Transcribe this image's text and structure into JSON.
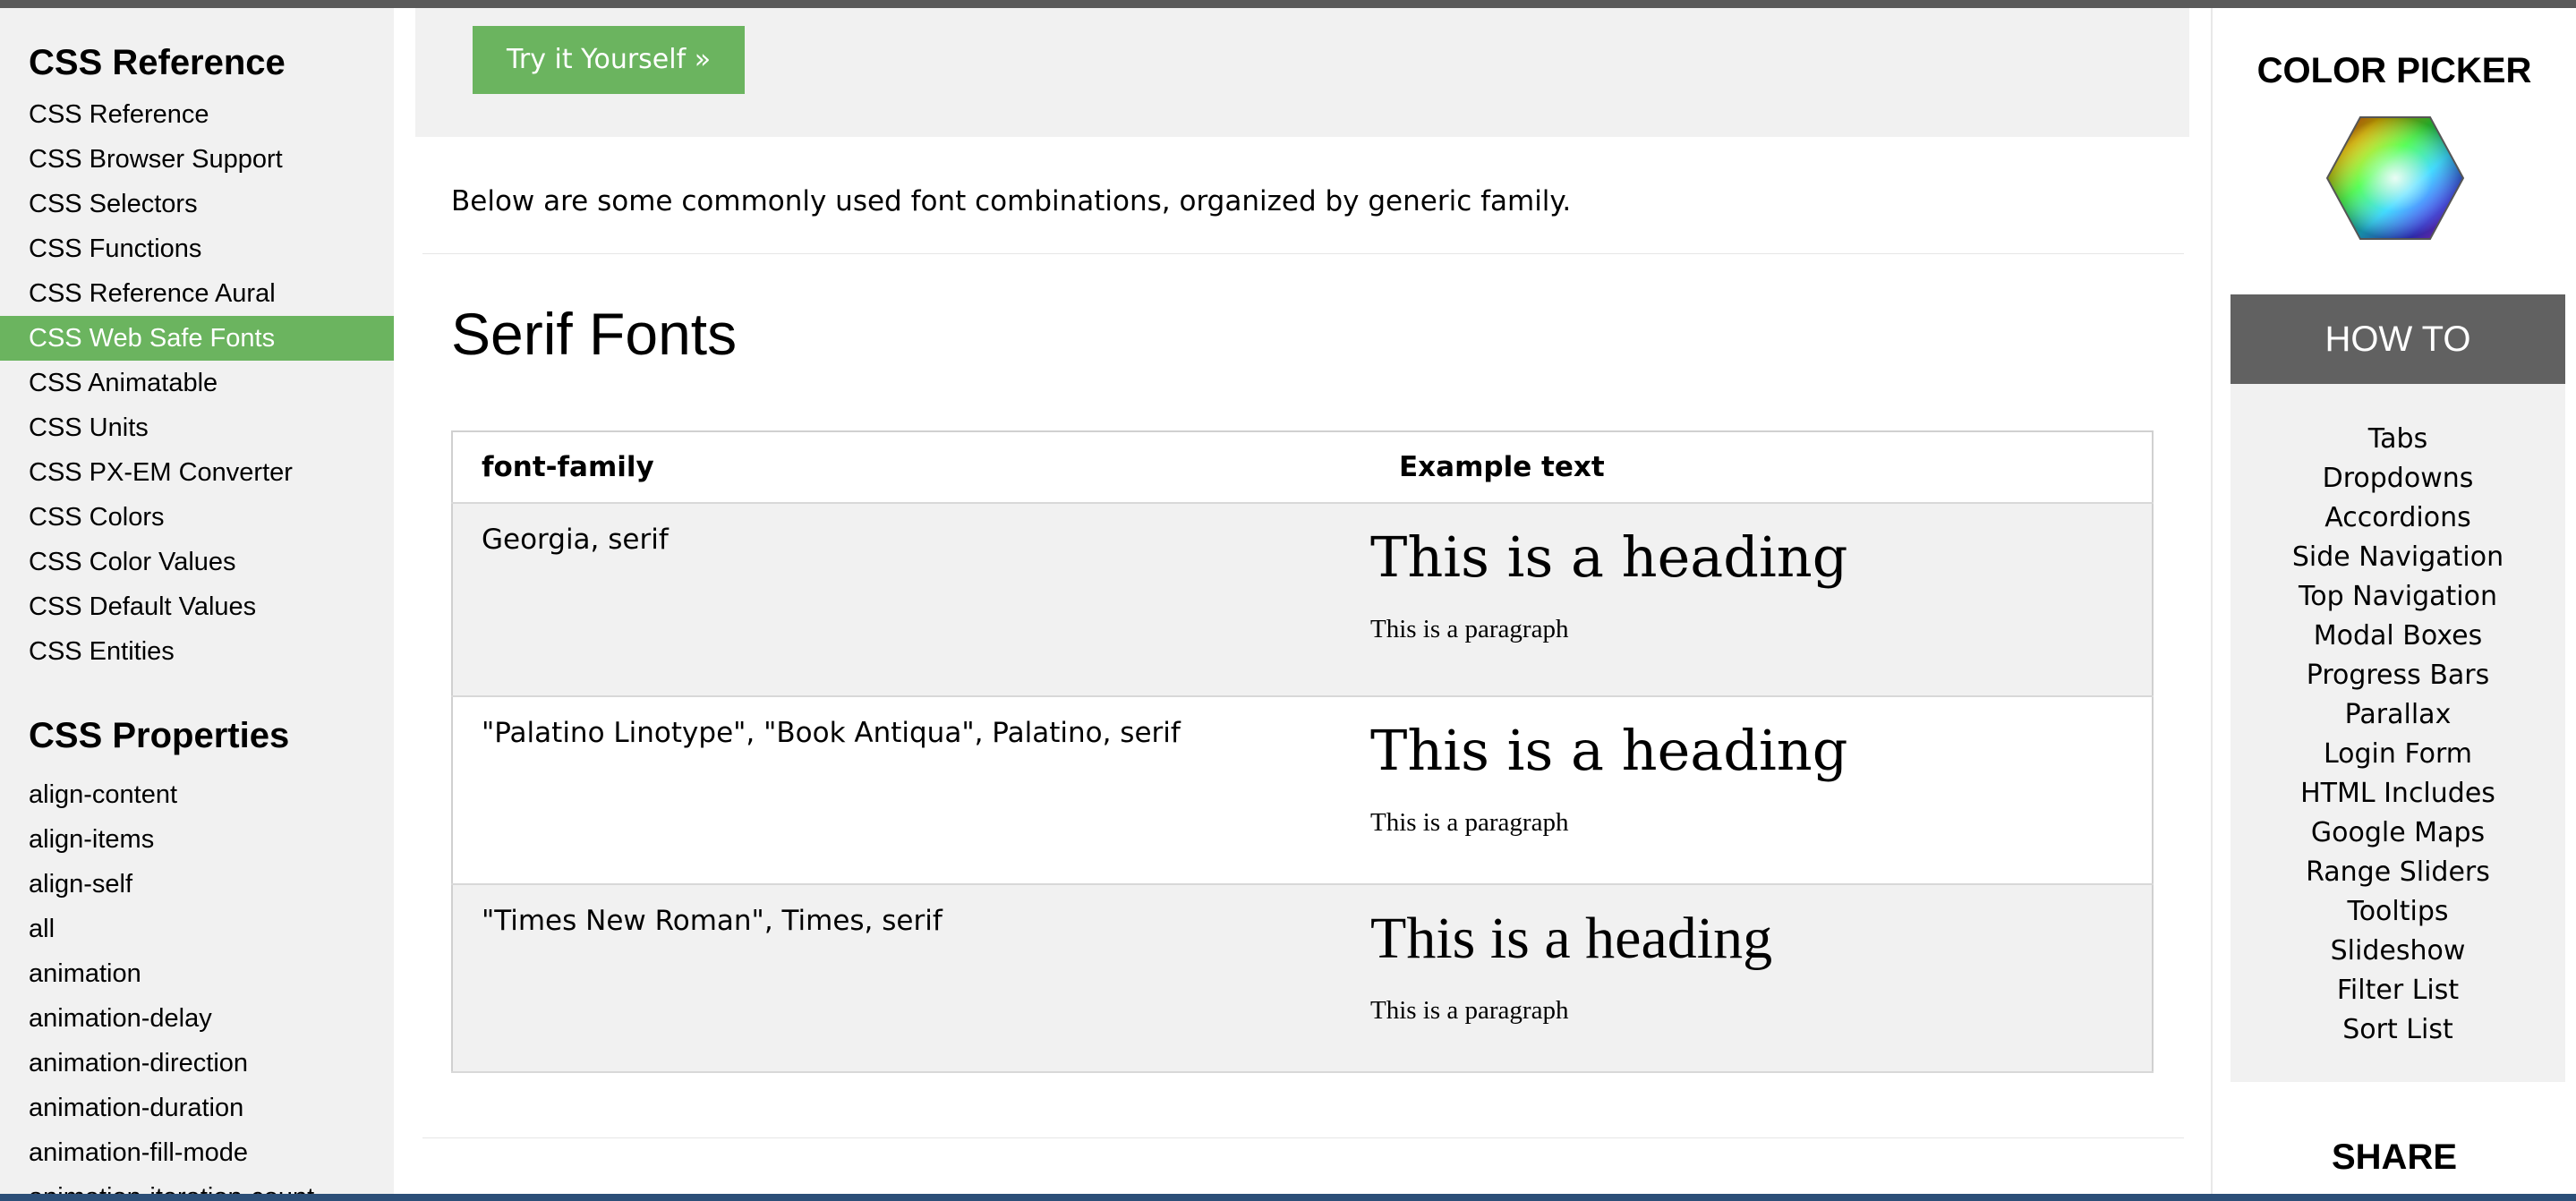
{
  "sidebar": {
    "reference_heading": "CSS Reference",
    "reference_links": [
      "CSS Reference",
      "CSS Browser Support",
      "CSS Selectors",
      "CSS Functions",
      "CSS Reference Aural",
      "CSS Web Safe Fonts",
      "CSS Animatable",
      "CSS Units",
      "CSS PX-EM Converter",
      "CSS Colors",
      "CSS Color Values",
      "CSS Default Values",
      "CSS Entities"
    ],
    "active_link": "CSS Web Safe Fonts",
    "properties_heading": "CSS Properties",
    "property_links": [
      "align-content",
      "align-items",
      "align-self",
      "all",
      "animation",
      "animation-delay",
      "animation-direction",
      "animation-duration",
      "animation-fill-mode",
      "animation-iteration-count"
    ]
  },
  "main": {
    "try_button": "Try it Yourself »",
    "intro": "Below are some commonly used font combinations, organized by generic family.",
    "section_title": "Serif Fonts",
    "table": {
      "headers": [
        "font-family",
        "Example text"
      ],
      "rows": [
        {
          "family": "Georgia, serif",
          "heading": "This is a heading",
          "paragraph": "This is a paragraph"
        },
        {
          "family": "\"Palatino Linotype\", \"Book Antiqua\", Palatino, serif",
          "heading": "This is a heading",
          "paragraph": "This is a paragraph"
        },
        {
          "family": "\"Times New Roman\", Times, serif",
          "heading": "This is a heading",
          "paragraph": "This is a paragraph"
        }
      ]
    }
  },
  "rightbar": {
    "color_picker_title": "COLOR PICKER",
    "color_picker_icon": "color-hexagon-icon",
    "howto_title": "HOW TO",
    "howto_links": [
      "Tabs",
      "Dropdowns",
      "Accordions",
      "Side Navigation",
      "Top Navigation",
      "Modal Boxes",
      "Progress Bars",
      "Parallax",
      "Login Form",
      "HTML Includes",
      "Google Maps",
      "Range Sliders",
      "Tooltips",
      "Slideshow",
      "Filter List",
      "Sort List"
    ],
    "share_title": "SHARE"
  },
  "colors": {
    "accent_green": "#6bb45f",
    "panel_gray": "#f1f1f1",
    "howto_header": "#616161"
  }
}
